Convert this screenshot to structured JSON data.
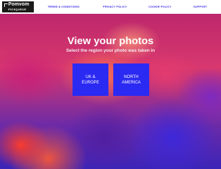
{
  "brand": {
    "name": "Pomvom",
    "sub": "PICSQUEUE"
  },
  "nav": {
    "terms": "TERMS & CONDITIONS",
    "privacy": "PRIVACY POLICY",
    "cookie": "COOKIE POLICY",
    "support": "SUPPORT"
  },
  "main": {
    "title": "View your photos",
    "subtitle": "Select the region your photo was taken in",
    "regions": [
      {
        "line1": "UK &",
        "line2": "EUROPE"
      },
      {
        "line1": "NORTH",
        "line2": "AMERICA"
      }
    ]
  },
  "colors": {
    "accent": "#2b2af2",
    "nav_link": "#3a2ee0",
    "logo_bg": "#1a1a1a",
    "navbar_bg": "#ffffff"
  }
}
